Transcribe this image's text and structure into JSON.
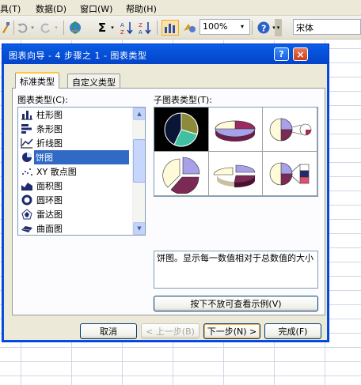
{
  "menubar": {
    "items": [
      "具(T)",
      "数据(D)",
      "窗口(W)",
      "帮助(H)"
    ]
  },
  "toolbar": {
    "sigma": "Σ",
    "zoom_value": "100%",
    "font_name": "宋体"
  },
  "dialog": {
    "title": "图表向导 - 4 步骤之 1 - 图表类型",
    "help_label": "?",
    "close_label": "×",
    "tabs": [
      "标准类型",
      "自定义类型"
    ],
    "type_list_label": "图表类型(C):",
    "subtype_label": "子图表类型(T):",
    "chart_types": [
      {
        "label": "柱形图",
        "icon": "column-chart-icon"
      },
      {
        "label": "条形图",
        "icon": "bar-chart-icon"
      },
      {
        "label": "折线图",
        "icon": "line-chart-icon"
      },
      {
        "label": "饼图",
        "icon": "pie-chart-icon",
        "selected": true
      },
      {
        "label": "XY 散点图",
        "icon": "scatter-chart-icon"
      },
      {
        "label": "面积图",
        "icon": "area-chart-icon"
      },
      {
        "label": "圆环图",
        "icon": "doughnut-chart-icon"
      },
      {
        "label": "雷达图",
        "icon": "radar-chart-icon"
      },
      {
        "label": "曲面图",
        "icon": "surface-chart-icon"
      }
    ],
    "description": "饼图。显示每一数值相对于总数值的大小",
    "preview_button": "按下不放可查看示例(V)",
    "buttons": {
      "cancel": "取消",
      "back": "< 上一步(B)",
      "next": "下一步(N) >",
      "finish": "完成(F)"
    }
  }
}
